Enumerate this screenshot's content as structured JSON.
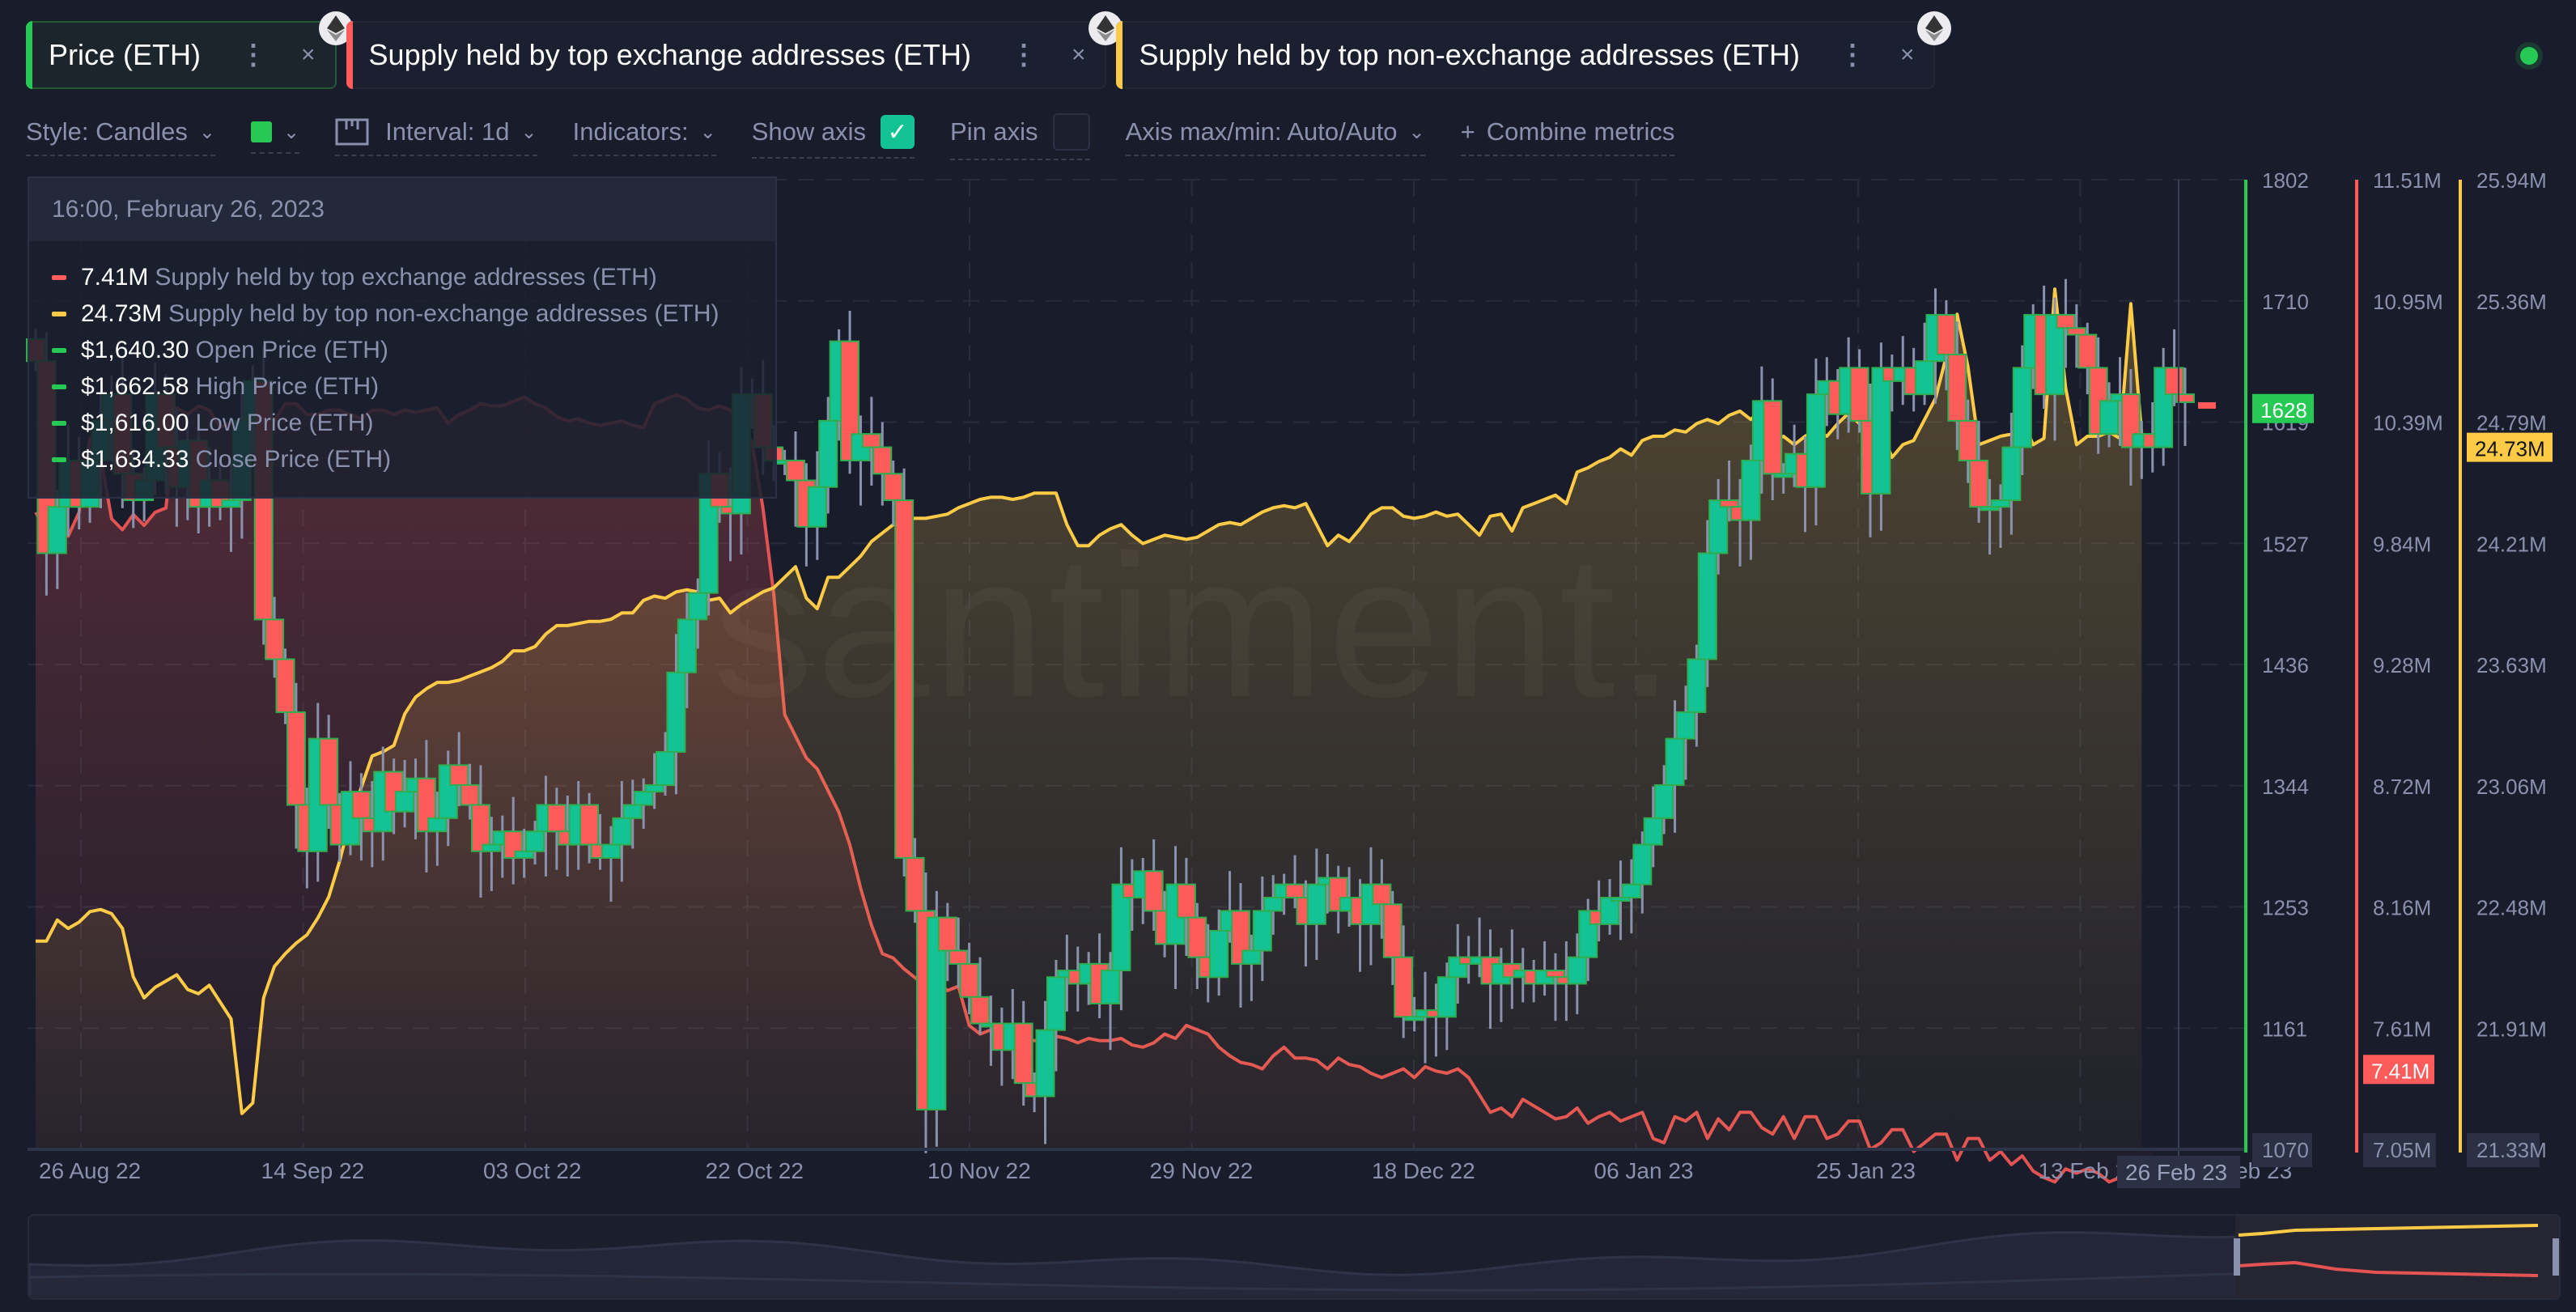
{
  "tabs": [
    {
      "label": "Price (ETH)",
      "color": "#26c953",
      "active": true,
      "icon": "ethereum-icon"
    },
    {
      "label": "Supply held by top exchange addresses (ETH)",
      "color": "#ff5b5b",
      "active": false,
      "icon": "ethereum-icon"
    },
    {
      "label": "Supply held by top non-exchange addresses (ETH)",
      "color": "#ffcb47",
      "active": false,
      "icon": "ethereum-icon"
    }
  ],
  "tab_menu_icon": "⋮",
  "tab_close_icon": "×",
  "toolbar": {
    "style_label": "Style: Candles",
    "color_swatch": "#26c953",
    "interval_label": "Interval: 1d",
    "indicators_label": "Indicators:",
    "show_axis_label": "Show axis",
    "show_axis_checked": true,
    "pin_axis_label": "Pin axis",
    "pin_axis_checked": false,
    "axis_minmax_label": "Axis max/min: Auto/Auto",
    "combine_label": "Combine metrics",
    "chevron": "⌄",
    "plus": "+",
    "check": "✓"
  },
  "watermark": "santiment.",
  "tooltip": {
    "date": "16:00, February 26, 2023",
    "rows": [
      {
        "value": "7.41M",
        "name": "Supply held by top exchange addresses (ETH)",
        "color": "#ff5b5b"
      },
      {
        "value": "24.73M",
        "name": "Supply held by top non-exchange addresses (ETH)",
        "color": "#ffcb47"
      },
      {
        "value": "$1,640.30",
        "name": "Open Price (ETH)",
        "color": "#26c953"
      },
      {
        "value": "$1,662.58",
        "name": "High Price (ETH)",
        "color": "#26c953"
      },
      {
        "value": "$1,616.00",
        "name": "Low Price (ETH)",
        "color": "#26c953"
      },
      {
        "value": "$1,634.33",
        "name": "Close Price (ETH)",
        "color": "#26c953"
      }
    ]
  },
  "chart_data": {
    "type": "candlestick+line",
    "title": "",
    "x_tick_labels": [
      "26 Aug 22",
      "14 Sep 22",
      "03 Oct 22",
      "22 Oct 22",
      "10 Nov 22",
      "29 Nov 22",
      "18 Dec 22",
      "06 Jan 23",
      "25 Jan 23",
      "13 Feb 23",
      "Feb 23"
    ],
    "crosshair_label": "26 Feb 23",
    "start_date": "2022-08-23",
    "axes": [
      {
        "name": "Price (ETH)",
        "color": "#26c953",
        "range": [
          1070,
          1802
        ],
        "ticks": [
          "1802",
          "1710",
          "1619",
          "1527",
          "1436",
          "1344",
          "1253",
          "1161",
          "1070"
        ],
        "current": "1628",
        "min_label": "1070"
      },
      {
        "name": "Supply held by top exchange addresses (ETH)",
        "color": "#ff5b5b",
        "range": [
          7.05,
          11.51
        ],
        "unit": "M",
        "ticks": [
          "11.51M",
          "10.95M",
          "10.39M",
          "9.84M",
          "9.28M",
          "8.72M",
          "8.16M",
          "7.61M",
          "7.05M"
        ],
        "current": "7.41M",
        "min_label": "7.05M"
      },
      {
        "name": "Supply held by top non-exchange addresses (ETH)",
        "color": "#ffcb47",
        "range": [
          21.33,
          25.94
        ],
        "unit": "M",
        "ticks": [
          "25.94M",
          "25.36M",
          "24.79M",
          "24.21M",
          "23.63M",
          "23.06M",
          "22.48M",
          "21.91M",
          "21.33M"
        ],
        "current": "24.73M",
        "min_label": "21.33M"
      }
    ],
    "candles_close": [
      1665,
      1520,
      1555,
      1590,
      1555,
      1590,
      1620,
      1640,
      1580,
      1560,
      1575,
      1640,
      1600,
      1570,
      1605,
      1555,
      1575,
      1555,
      1560,
      1620,
      1650,
      1470,
      1440,
      1400,
      1330,
      1295,
      1380,
      1330,
      1300,
      1340,
      1320,
      1310,
      1355,
      1325,
      1340,
      1350,
      1310,
      1320,
      1360,
      1345,
      1330,
      1295,
      1300,
      1310,
      1290,
      1295,
      1310,
      1330,
      1310,
      1300,
      1330,
      1300,
      1290,
      1300,
      1320,
      1330,
      1340,
      1345,
      1370,
      1430,
      1470,
      1490,
      1580,
      1555,
      1550,
      1640,
      1640,
      1600,
      1590,
      1590,
      1575,
      1540,
      1570,
      1620,
      1680,
      1590,
      1610,
      1600,
      1580,
      1560,
      1290,
      1250,
      1100,
      1245,
      1220,
      1210,
      1185,
      1165,
      1165,
      1145,
      1165,
      1120,
      1110,
      1160,
      1200,
      1205,
      1195,
      1210,
      1180,
      1205,
      1270,
      1260,
      1280,
      1250,
      1225,
      1270,
      1245,
      1215,
      1200,
      1235,
      1250,
      1210,
      1220,
      1250,
      1260,
      1270,
      1260,
      1240,
      1270,
      1275,
      1250,
      1260,
      1240,
      1270,
      1255,
      1215,
      1170,
      1170,
      1175,
      1170,
      1200,
      1215,
      1210,
      1215,
      1195,
      1210,
      1200,
      1205,
      1195,
      1205,
      1200,
      1195,
      1215,
      1250,
      1240,
      1260,
      1260,
      1270,
      1300,
      1320,
      1345,
      1380,
      1400,
      1440,
      1520,
      1560,
      1555,
      1545,
      1590,
      1635,
      1580,
      1580,
      1595,
      1570,
      1640,
      1650,
      1625,
      1660,
      1620,
      1565,
      1660,
      1650,
      1660,
      1640,
      1665,
      1700,
      1670,
      1620,
      1590,
      1555,
      1555,
      1560,
      1600,
      1660,
      1700,
      1640,
      1700,
      1690,
      1685,
      1660,
      1610,
      1635,
      1640,
      1600,
      1610,
      1600,
      1660,
      1640,
      1634
    ],
    "exchange_supply_M": [
      9.98,
      9.9,
      9.93,
      9.87,
      9.98,
      10.32,
      10.23,
      9.95,
      9.9,
      9.97,
      9.92,
      9.98,
      10.0,
      10.46,
      10.43,
      10.47,
      10.45,
      10.37,
      10.39,
      10.38,
      10.47,
      10.47,
      10.4,
      10.48,
      10.48,
      10.43,
      10.43,
      10.45,
      10.45,
      10.43,
      10.41,
      10.45,
      10.45,
      10.43,
      10.45,
      10.44,
      10.45,
      10.46,
      10.39,
      10.43,
      10.45,
      10.48,
      10.47,
      10.47,
      10.49,
      10.51,
      10.48,
      10.46,
      10.42,
      10.4,
      10.41,
      10.39,
      10.38,
      10.39,
      10.4,
      10.38,
      10.37,
      10.48,
      10.5,
      10.52,
      10.5,
      10.46,
      10.45,
      10.47,
      10.45,
      10.38,
      10.3,
      10.0,
      9.6,
      9.05,
      8.95,
      8.85,
      8.8,
      8.7,
      8.6,
      8.45,
      8.25,
      8.08,
      7.95,
      7.93,
      7.88,
      7.84,
      7.8,
      7.82,
      7.78,
      7.8,
      7.62,
      7.58,
      7.6,
      7.57,
      7.58,
      7.56,
      7.55,
      7.55,
      7.57,
      7.56,
      7.54,
      7.56,
      7.55,
      7.55,
      7.56,
      7.53,
      7.52,
      7.54,
      7.58,
      7.56,
      7.62,
      7.6,
      7.58,
      7.52,
      7.48,
      7.45,
      7.44,
      7.42,
      7.48,
      7.52,
      7.47,
      7.47,
      7.46,
      7.42,
      7.47,
      7.44,
      7.43,
      7.4,
      7.38,
      7.4,
      7.42,
      7.38,
      7.43,
      7.41,
      7.4,
      7.42,
      7.38,
      7.3,
      7.22,
      7.24,
      7.2,
      7.28,
      7.25,
      7.22,
      7.19,
      7.2,
      7.24,
      7.17,
      7.2,
      7.22,
      7.18,
      7.2,
      7.22,
      7.1,
      7.08,
      7.2,
      7.18,
      7.22,
      7.1,
      7.19,
      7.14,
      7.22,
      7.22,
      7.15,
      7.12,
      7.2,
      7.1,
      7.2,
      7.2,
      7.1,
      7.12,
      7.18,
      7.18,
      7.05,
      7.08,
      7.14,
      7.14,
      7.04,
      7.08,
      7.12,
      7.12,
      7.0,
      7.1,
      7.1,
      7.0,
      7.04,
      6.98,
      7.02,
      6.95,
      6.92,
      6.9,
      6.96,
      6.94,
      6.96,
      6.94,
      6.9,
      6.92,
      6.98,
      6.92,
      6.92
    ],
    "nonexchange_supply_M": [
      22.32,
      22.32,
      22.42,
      22.38,
      22.41,
      22.46,
      22.47,
      22.45,
      22.38,
      22.15,
      22.05,
      22.1,
      22.13,
      22.16,
      22.09,
      22.07,
      22.11,
      22.03,
      21.95,
      21.5,
      21.55,
      22.05,
      22.2,
      22.26,
      22.31,
      22.35,
      22.43,
      22.53,
      22.7,
      22.9,
      23.05,
      23.2,
      23.22,
      23.25,
      23.4,
      23.48,
      23.52,
      23.55,
      23.55,
      23.56,
      23.58,
      23.6,
      23.62,
      23.65,
      23.7,
      23.7,
      23.72,
      23.78,
      23.82,
      23.82,
      23.83,
      23.84,
      23.84,
      23.85,
      23.88,
      23.88,
      23.94,
      23.96,
      23.95,
      23.98,
      23.99,
      23.98,
      23.94,
      23.95,
      23.88,
      23.92,
      23.95,
      23.98,
      24.0,
      24.05,
      24.1,
      23.95,
      23.9,
      24.05,
      24.05,
      24.1,
      24.15,
      24.22,
      24.26,
      24.3,
      24.32,
      24.33,
      24.33,
      24.34,
      24.35,
      24.38,
      24.4,
      24.42,
      24.43,
      24.43,
      24.42,
      24.43,
      24.45,
      24.45,
      24.45,
      24.3,
      24.2,
      24.2,
      24.25,
      24.28,
      24.3,
      24.25,
      24.21,
      24.23,
      24.25,
      24.24,
      24.23,
      24.24,
      24.27,
      24.3,
      24.31,
      24.3,
      24.33,
      24.36,
      24.38,
      24.39,
      24.38,
      24.4,
      24.3,
      24.2,
      24.25,
      24.22,
      24.28,
      24.35,
      24.38,
      24.38,
      24.34,
      24.33,
      24.34,
      24.36,
      24.34,
      24.35,
      24.3,
      24.25,
      24.34,
      24.35,
      24.27,
      24.38,
      24.4,
      24.42,
      24.44,
      24.4,
      24.55,
      24.57,
      24.6,
      24.62,
      24.66,
      24.63,
      24.7,
      24.72,
      24.72,
      24.75,
      24.74,
      24.78,
      24.8,
      24.78,
      24.82,
      24.84,
      24.8,
      24.85,
      24.7,
      24.72,
      24.68,
      24.72,
      24.75,
      24.72,
      24.78,
      24.83,
      24.78,
      24.95,
      24.75,
      24.62,
      24.68,
      24.7,
      24.8,
      24.9,
      25.1,
      25.3,
      25.05,
      24.68,
      24.7,
      24.72,
      24.73,
      24.8,
      24.68,
      24.71,
      25.42,
      24.95,
      24.68,
      24.72,
      24.72,
      24.74,
      24.71,
      25.35,
      24.73
    ]
  }
}
